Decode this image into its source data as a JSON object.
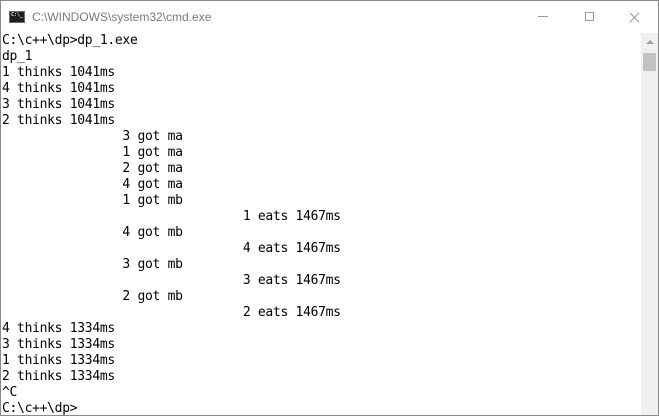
{
  "window": {
    "title": "C:\\WINDOWS\\system32\\cmd.exe",
    "icon": "cmd-icon",
    "icon_text": "C:\\_"
  },
  "console": {
    "lines": [
      "C:\\c++\\dp>dp_1.exe",
      "dp_1",
      "1 thinks 1041ms",
      "4 thinks 1041ms",
      "3 thinks 1041ms",
      "2 thinks 1041ms",
      "                3 got ma",
      "                1 got ma",
      "                2 got ma",
      "                4 got ma",
      "                1 got mb",
      "                                1 eats 1467ms",
      "                4 got mb",
      "                                4 eats 1467ms",
      "                3 got mb",
      "                                3 eats 1467ms",
      "                2 got mb",
      "                                2 eats 1467ms",
      "4 thinks 1334ms",
      "3 thinks 1334ms",
      "1 thinks 1334ms",
      "2 thinks 1334ms",
      "^C",
      "C:\\c++\\dp>"
    ]
  }
}
